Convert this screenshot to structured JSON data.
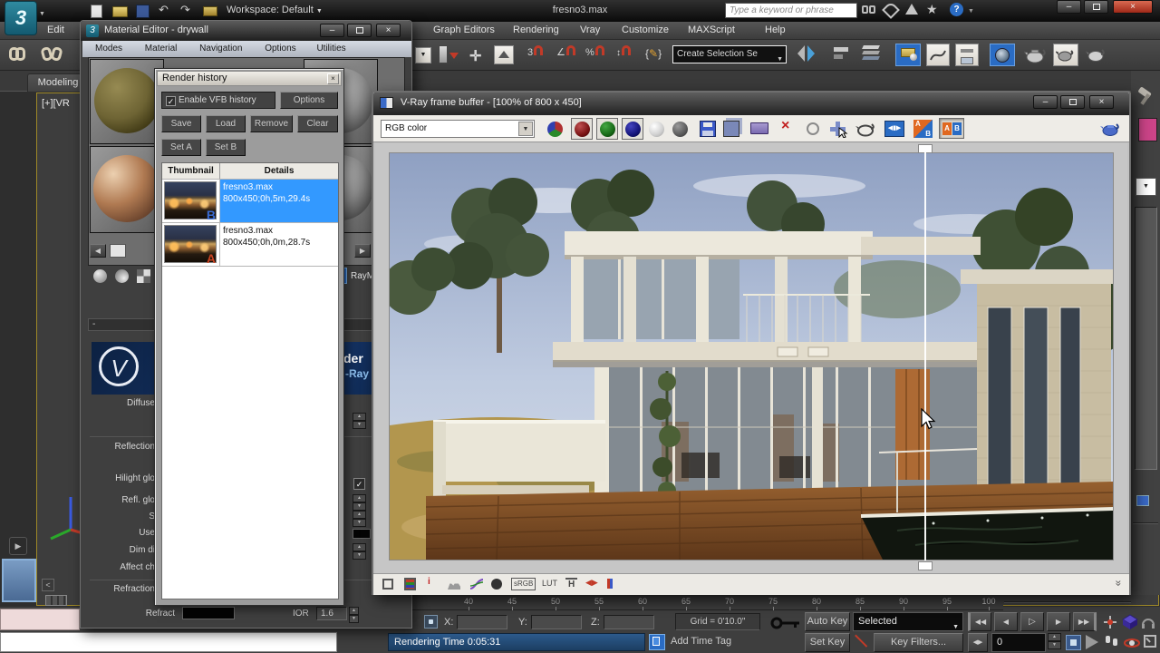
{
  "window": {
    "title": "fresno3.max",
    "workspace": "Workspace: Default",
    "search_placeholder": "Type a keyword or phrase"
  },
  "menus": {
    "edit": "Edit",
    "graph_editors": "Graph Editors",
    "rendering": "Rendering",
    "vray": "Vray",
    "customize": "Customize",
    "maxscript": "MAXScript",
    "help": "Help"
  },
  "toolbar": {
    "selection_set": "Create Selection Se",
    "snap3": "3",
    "snap_percent": "%"
  },
  "ribbon": {
    "modeling": "Modeling"
  },
  "viewport": {
    "label": "[+][VR"
  },
  "material_editor": {
    "title": "Material Editor - drywall",
    "menu": [
      "Modes",
      "Material",
      "Navigation",
      "Options",
      "Utilities"
    ],
    "type_fragment": "RayM",
    "rollout_collapse": "-",
    "banner_line1": "der",
    "banner_line2": "-Ray",
    "params": {
      "diffuse": "Diffuse",
      "reflection": "Reflection",
      "hilight": "Hilight glo",
      "refl_glo": "Refl. glo",
      "s": "S",
      "use": "Use",
      "dim": "Dim di",
      "affect": "Affect ch",
      "refraction": "Refraction",
      "refract": "Refract",
      "ior_label": "IOR",
      "ior_value": "1.6"
    }
  },
  "render_history": {
    "title": "Render history",
    "enable_label": "Enable VFB history",
    "options": "Options",
    "save": "Save",
    "load": "Load",
    "remove": "Remove",
    "clear": "Clear",
    "set_a": "Set A",
    "set_b": "Set B",
    "col_thumbnail": "Thumbnail",
    "col_details": "Details",
    "rows": [
      {
        "line1": "fresno3.max",
        "line2": "800x450;0h,5m,29.4s",
        "tag": "B"
      },
      {
        "line1": "fresno3.max",
        "line2": "800x450;0h,0m,28.7s",
        "tag": "A"
      }
    ]
  },
  "vfb": {
    "title": "V-Ray frame buffer - [100% of 800 x 450]",
    "channel": "RGB color",
    "ab_a": "A",
    "ab_b": "B",
    "info": "i",
    "srgb": "sRGB",
    "lut": "LUT",
    "h": "H"
  },
  "status": {
    "rendering_time": "Rendering Time 0:05:31",
    "add_time_tag": "Add Time Tag",
    "x": "X:",
    "y": "Y:",
    "z": "Z:",
    "grid": "Grid = 0'10.0\"",
    "auto_key": "Auto Key",
    "set_key": "Set Key",
    "selected": "Selected",
    "key_filters": "Key Filters...",
    "frame": "0",
    "ticks": [
      "40",
      "45",
      "50",
      "55",
      "60",
      "65",
      "70",
      "75",
      "80",
      "85",
      "90",
      "95",
      "100"
    ]
  },
  "icons": {
    "close_x": "×",
    "minimize": "–",
    "dropdown": "▼",
    "spin_up": "▲",
    "spin_down": "▼",
    "check": "✓",
    "arrow_left": "◀",
    "arrow_right": "▶",
    "play": "▷",
    "double_left": "◀◀",
    "double_right": "▶▶",
    "undo": "↶",
    "redo": "↷",
    "star": "★",
    "help": "?",
    "chevrons": "»",
    "lt": "<"
  },
  "colors": {
    "selection_blue": "#3399ff",
    "toolbar_highlight": "#2a6cc4",
    "close_red": "#c23a2a"
  }
}
